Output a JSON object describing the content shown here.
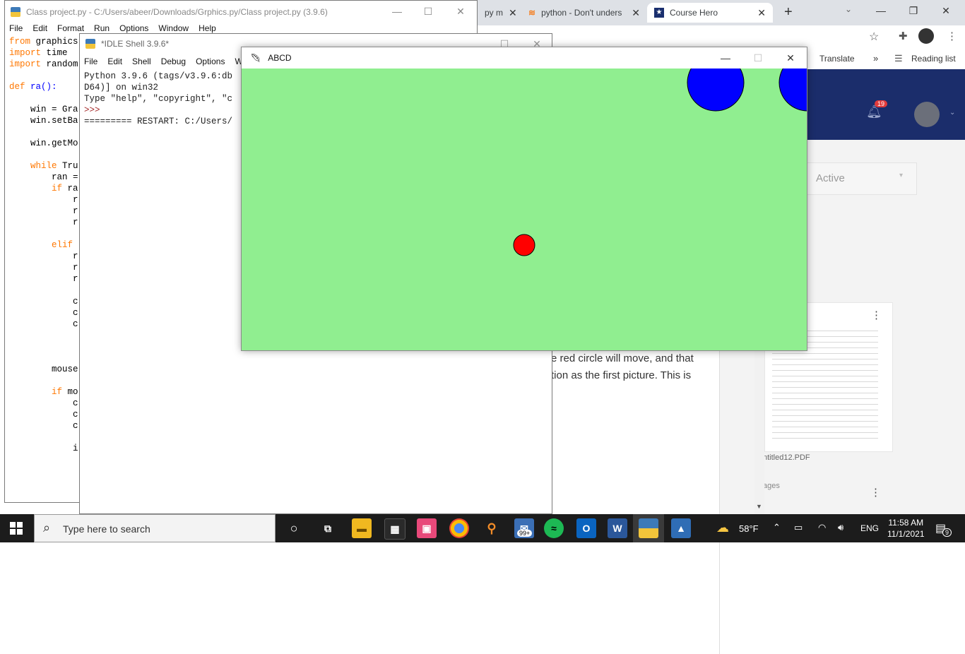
{
  "chrome": {
    "tabs": [
      {
        "label": "py m",
        "icon": "code-icon"
      },
      {
        "label": "python - Don't unders",
        "icon": "stackoverflow-icon"
      },
      {
        "label": "Course Hero",
        "icon": "coursehero-icon"
      }
    ],
    "translate_label": "Translate",
    "overflow_label": "»",
    "reading_list_label": "Reading list",
    "notification_count": "19",
    "active_label": "Active",
    "post_text_line1": "e red circle will move, and that",
    "post_text_line2": "tion as the first picture. This is",
    "pdf_label": "ntitled12.PDF",
    "pages_label": "ages"
  },
  "editor": {
    "title": "Class project.py - C:/Users/abeer/Downloads/Grphics.py/Class project.py (3.9.6)",
    "menu": [
      "File",
      "Edit",
      "Format",
      "Run",
      "Options",
      "Window",
      "Help"
    ],
    "code_lines": [
      "from graphics",
      "import time",
      "import random",
      "",
      "def ra():",
      "",
      "    win = Gra",
      "    win.setBa",
      "",
      "    win.getMo",
      "",
      "    while Tru",
      "        ran =",
      "        if ra",
      "            r",
      "            r",
      "            r",
      "",
      "        elif",
      "            r",
      "            r",
      "            r",
      "",
      "            c",
      "            c",
      "            c",
      "",
      "",
      "",
      "        mouse",
      "",
      "        if mo",
      "            c",
      "            c",
      "            c",
      "",
      "            i"
    ]
  },
  "shell": {
    "title": "*IDLE Shell 3.9.6*",
    "menu": [
      "File",
      "Edit",
      "Shell",
      "Debug",
      "Options",
      "W"
    ],
    "lines": [
      "Python 3.9.6 (tags/v3.9.6:db",
      "D64)] on win32",
      "Type \"help\", \"copyright\", \"c",
      ">>>",
      "========= RESTART: C:/Users/"
    ]
  },
  "abcd": {
    "title": "ABCD",
    "canvas_color": "#90ee90",
    "circles": [
      {
        "name": "blue-circle-1",
        "color": "#0000ff"
      },
      {
        "name": "blue-circle-2",
        "color": "#0000ff"
      },
      {
        "name": "red-circle",
        "color": "#ff0000"
      }
    ]
  },
  "taskbar": {
    "search_placeholder": "Type here to search",
    "badge": "99+",
    "weather": "58°F",
    "lang": "ENG",
    "time": "11:58 AM",
    "date": "11/1/2021",
    "notif_count": "9"
  }
}
